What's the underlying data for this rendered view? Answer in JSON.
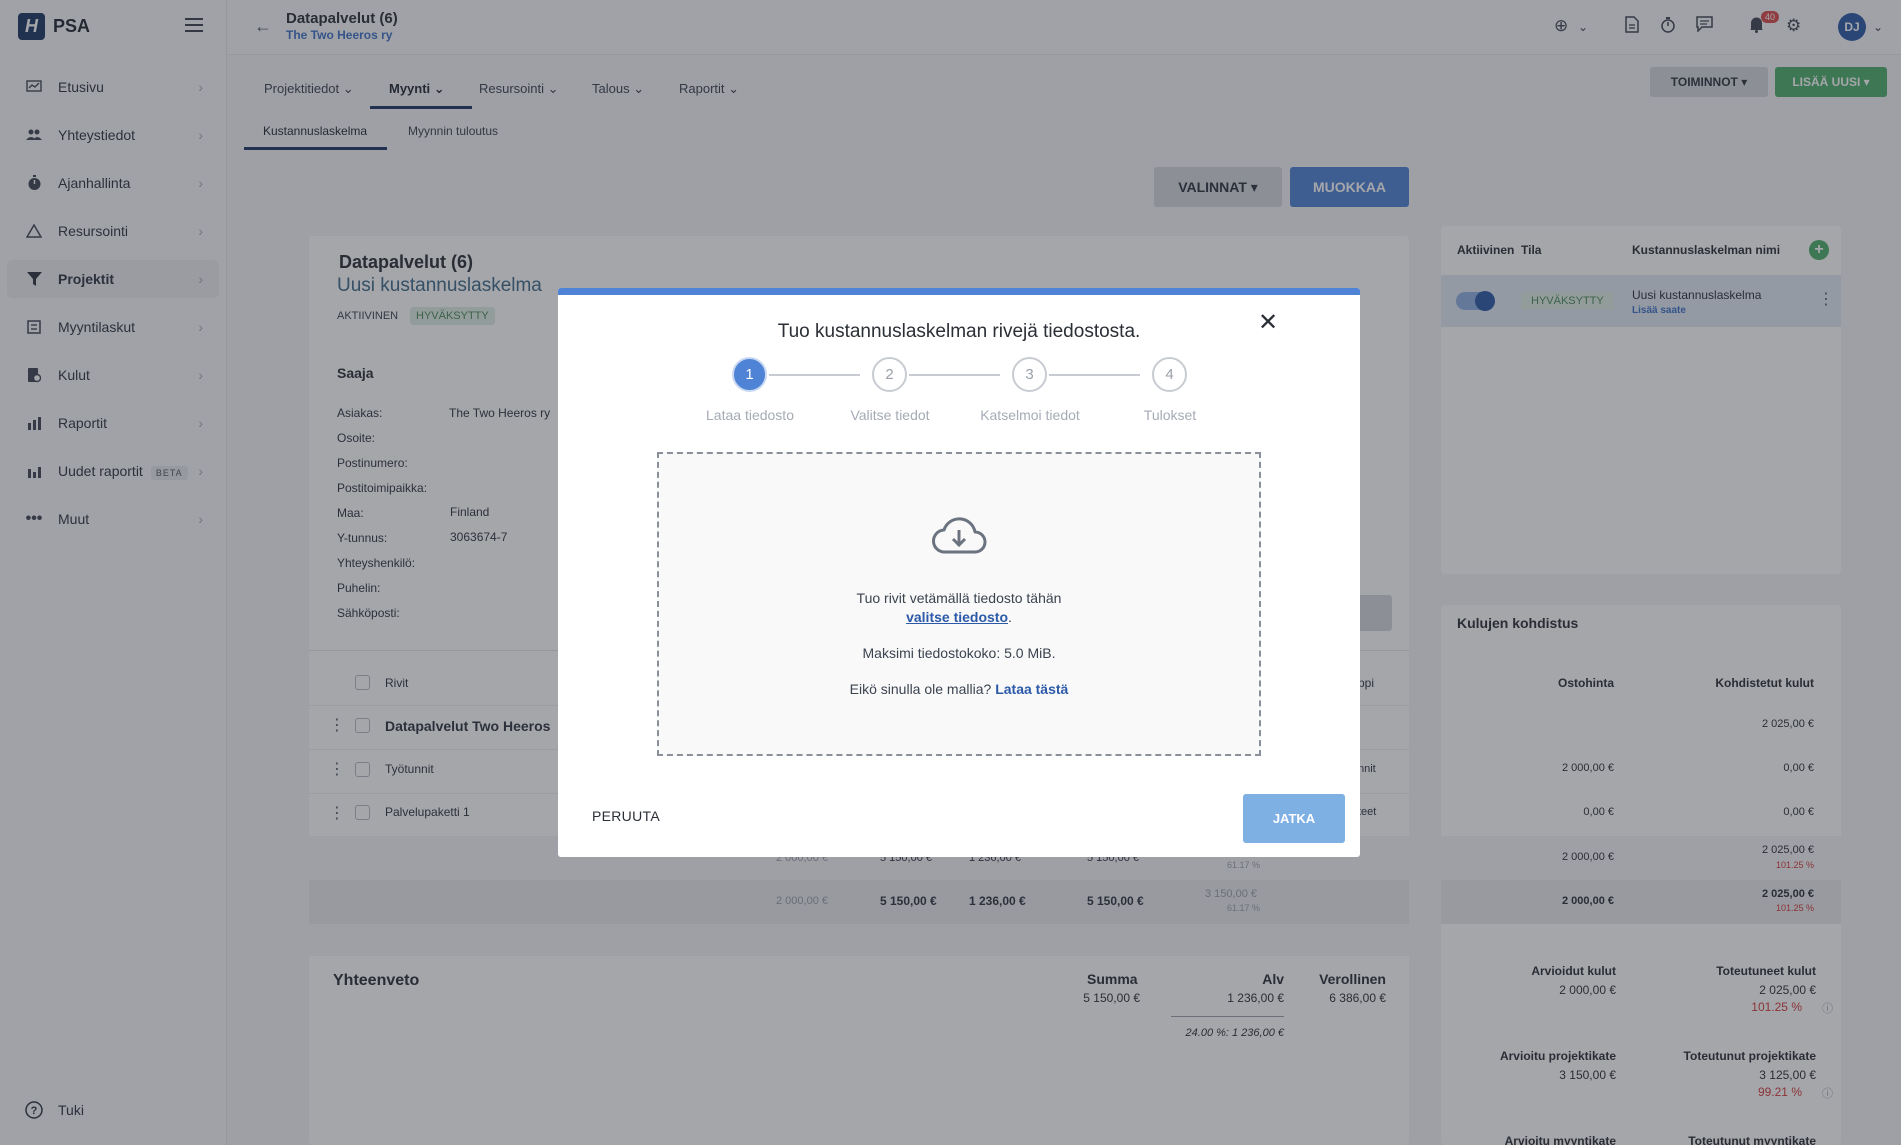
{
  "app": {
    "name": "PSA",
    "logo_letter": "H"
  },
  "sidebar": {
    "items": [
      {
        "label": "Etusivu",
        "icon": "chart-icon"
      },
      {
        "label": "Yhteystiedot",
        "icon": "people-icon"
      },
      {
        "label": "Ajanhallinta",
        "icon": "stopwatch-icon"
      },
      {
        "label": "Resursointi",
        "icon": "resource-icon"
      },
      {
        "label": "Projektit",
        "icon": "filter-icon"
      },
      {
        "label": "Myyntilaskut",
        "icon": "invoice-icon"
      },
      {
        "label": "Kulut",
        "icon": "receipt-icon"
      },
      {
        "label": "Raportit",
        "icon": "bar-chart-icon"
      },
      {
        "label": "Uudet raportit",
        "icon": "bar-chart-icon",
        "badge": "BETA"
      },
      {
        "label": "Muut",
        "icon": "more-icon"
      }
    ],
    "help_label": "Tuki"
  },
  "header": {
    "project_title": "Datapalvelut (6)",
    "client": "The Two Heeros ry",
    "notification_count": "40",
    "user_initials": "DJ"
  },
  "tabs": [
    "Projektitiedot",
    "Myynti",
    "Resursointi",
    "Talous",
    "Raportit"
  ],
  "subtabs": [
    "Kustannuslaskelma",
    "Myynnin tuloutus"
  ],
  "actions": {
    "toiminnot": "TOIMINNOT",
    "lisaa_uusi": "LISÄÄ UUSI",
    "valinnat": "VALINNAT",
    "muokkaa": "MUOKKAA"
  },
  "main": {
    "title": "Datapalvelut (6)",
    "subtitle": "Uusi kustannuslaskelma",
    "status_active": "AKTIIVINEN",
    "status_badge": "HYVÄKSYTTY",
    "recipient_heading": "Saaja",
    "fields": [
      {
        "label": "Asiakas:",
        "value": "The Two Heeros ry"
      },
      {
        "label": "Osoite:",
        "value": ""
      },
      {
        "label": "Postinumero:",
        "value": ""
      },
      {
        "label": "Postitoimipaikka:",
        "value": ""
      },
      {
        "label": "Maa:",
        "value": "Finland"
      },
      {
        "label": "Y-tunnus:",
        "value": "3063674-7"
      },
      {
        "label": "Yhteyshenkilö:",
        "value": ""
      },
      {
        "label": "Puhelin:",
        "value": ""
      },
      {
        "label": "Sähköposti:",
        "value": ""
      }
    ],
    "rows_header": "Rivit",
    "type_header_fragment": "yppi",
    "rows": [
      {
        "name": "Datapalvelut Two Heeros",
        "type": ""
      },
      {
        "name": "Työtunnit",
        "type": "nnit"
      },
      {
        "name": "Palvelupaketti 1",
        "type": "teet"
      }
    ],
    "subtotal_row": {
      "purchase": "2 000,00 €",
      "sale": "5 150,00 €",
      "vat": "1 236,00 €",
      "total": "5 150,00 €",
      "margin": "3 150,00 €",
      "margin_pct": "61.17 %"
    },
    "hidden_row": {
      "purchase": "2 000,00 €",
      "sale": "5 150,00 €",
      "vat": "1 236,00 €",
      "total": "5 150,00 €",
      "margin_pct": "61.17 %"
    },
    "summary": {
      "heading": "Yhteenveto",
      "sum_label": "Summa",
      "sum_value": "5 150,00 €",
      "vat_label": "Alv",
      "vat_value": "1 236,00 €",
      "gross_label": "Verollinen",
      "gross_value": "6 386,00 €",
      "vat_breakdown": "24.00 %:  1 236,00 €"
    }
  },
  "right_panel": {
    "headers": {
      "active": "Aktiivinen",
      "state": "Tila",
      "name": "Kustannuslaskelman nimi"
    },
    "calc": {
      "status": "HYVÄKSYTTY",
      "name": "Uusi kustannuslaskelma",
      "link": "Lisää saate"
    },
    "allocation": {
      "heading": "Kulujen kohdistus",
      "col_purchase": "Ostohinta",
      "col_allocated": "Kohdistetut kulut",
      "rows": [
        {
          "purchase": "",
          "allocated": "2 025,00 €",
          "pct": ""
        },
        {
          "purchase": "2 000,00 €",
          "allocated": "0,00 €",
          "pct": ""
        },
        {
          "purchase": "0,00 €",
          "allocated": "0,00 €",
          "pct": ""
        },
        {
          "purchase": "2 000,00 €",
          "allocated": "2 025,00 €",
          "pct": "101.25 %"
        },
        {
          "purchase": "2 000,00 €",
          "allocated": "2 025,00 €",
          "pct": "101.25 %"
        }
      ],
      "est_costs_label": "Arvioidut kulut",
      "est_costs": "2 000,00 €",
      "real_costs_label": "Toteutuneet kulut",
      "real_costs": "2 025,00 €",
      "real_costs_pct": "101.25 %",
      "est_margin_label": "Arvioitu projektikate",
      "est_margin": "3 150,00 €",
      "real_margin_label": "Toteutunut projektikate",
      "real_margin": "3 125,00 €",
      "real_margin_pct": "99.21 %",
      "est_sales_label": "Arvioitu myyntikate",
      "real_sales_label": "Toteutunut myyntikate"
    }
  },
  "modal": {
    "title": "Tuo kustannuslaskelman rivejä tiedostosta.",
    "steps": [
      {
        "num": "1",
        "label": "Lataa tiedosto"
      },
      {
        "num": "2",
        "label": "Valitse tiedot"
      },
      {
        "num": "3",
        "label": "Katselmoi tiedot"
      },
      {
        "num": "4",
        "label": "Tulokset"
      }
    ],
    "drop_text": "Tuo rivit vetämällä tiedosto tähän",
    "choose_file_link": "valitse tiedosto",
    "max_size": "Maksimi tiedostokoko: 5.0 MiB.",
    "no_template": "Eikö sinulla ole mallia?",
    "download_link": "Lataa tästä",
    "cancel": "PERUUTA",
    "next": "JATKA"
  }
}
